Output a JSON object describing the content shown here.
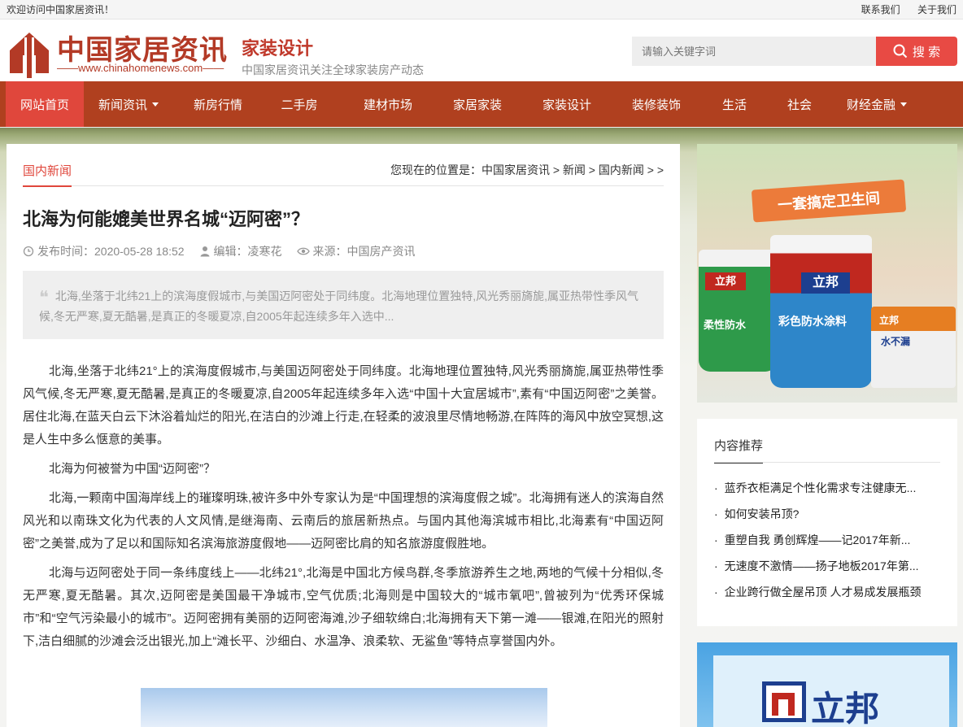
{
  "topbar": {
    "welcome": "欢迎访问中国家居资讯！",
    "contact": "联系我们",
    "about": "关于我们"
  },
  "header": {
    "logo_title": "中国家居资讯",
    "logo_url": "www.chinahomenews.com",
    "channel": "家装设计",
    "tagline": "中国家居资讯关注全球家装房产动态",
    "search_placeholder": "请输入关键字词",
    "search_button": "搜 索"
  },
  "nav": {
    "items": [
      {
        "label": "网站首页"
      },
      {
        "label": "新闻资讯"
      },
      {
        "label": "新房行情"
      },
      {
        "label": "二手房"
      },
      {
        "label": "建材市场"
      },
      {
        "label": "家居家装"
      },
      {
        "label": "家装设计"
      },
      {
        "label": "装修装饰"
      },
      {
        "label": "生活"
      },
      {
        "label": "社会"
      },
      {
        "label": "财经金融"
      }
    ]
  },
  "article": {
    "category_tab": "国内新闻",
    "breadcrumb": "您现在的位置是：中国家居资讯 > 新闻 > 国内新闻 > >",
    "title": "北海为何能媲美世界名城“迈阿密”？",
    "publish_time": "发布时间：2020-05-28 18:52",
    "editor": "编辑：凌寒花",
    "source": "来源：中国房产资讯",
    "summary": "北海,坐落于北纬21上的滨海度假城市,与美国迈阿密处于同纬度。北海地理位置独特,风光秀丽旖旎,属亚热带性季风气候,冬无严寒,夏无酷暑,是真正的冬暖夏凉,自2005年起连续多年入选中...",
    "paragraphs": [
      "北海,坐落于北纬21°上的滨海度假城市,与美国迈阿密处于同纬度。北海地理位置独特,风光秀丽旖旎,属亚热带性季风气候,冬无严寒,夏无酷暑,是真正的冬暖夏凉,自2005年起连续多年入选“中国十大宜居城市”,素有“中国迈阿密”之美誉。居住北海,在蓝天白云下沐浴着灿烂的阳光,在洁白的沙滩上行走,在轻柔的波浪里尽情地畅游,在阵阵的海风中放空冥想,这是人生中多么惬意的美事。",
      "北海为何被誉为中国“迈阿密”？",
      "北海,一颗南中国海岸线上的璀璨明珠,被许多中外专家认为是“中国理想的滨海度假之城”。北海拥有迷人的滨海自然风光和以南珠文化为代表的人文风情,是继海南、云南后的旅居新热点。与国内其他海滨城市相比,北海素有“中国迈阿密”之美誉,成为了足以和国际知名滨海旅游度假地——迈阿密比肩的知名旅游度假胜地。",
      "北海与迈阿密处于同一条纬度线上——北纬21°,北海是中国北方候鸟群,冬季旅游养生之地,两地的气候十分相似,冬无严寒,夏无酷暑。其次,迈阿密是美国最干净城市,空气优质;北海则是中国较大的“城市氧吧”,曾被列为“优秀环保城市”和“空气污染最小的城市”。迈阿密拥有美丽的迈阿密海滩,沙子细软绵白;北海拥有天下第一滩——银滩,在阳光的照射下,洁白细腻的沙滩会泛出银光,加上“滩长平、沙细白、水温净、浪柔软、无鲨鱼”等特点享誉国内外。"
    ]
  },
  "sidebar": {
    "ad1_slogan": "一套搞定卫生间",
    "ad1_brand": "立邦",
    "ad1_product_a": "柔性防水",
    "ad1_product_b": "彩色防水涂料",
    "ad1_product_c": "水不漏",
    "recommend_title": "内容推荐",
    "recommend_items": [
      "蓝乔衣柜满足个性化需求专注健康无...",
      "如何安装吊顶?",
      "重塑自我 勇创辉煌——记2017年新...",
      "无速度不激情——扬子地板2017年第...",
      "企业跨行做全屋吊顶 人才易成发展瓶颈"
    ],
    "ad2_brand": "立邦"
  },
  "colors": {
    "nav_bg": "#b0401f",
    "nav_active": "#e0473c",
    "accent": "#e84a44",
    "logo": "#b33a26"
  }
}
